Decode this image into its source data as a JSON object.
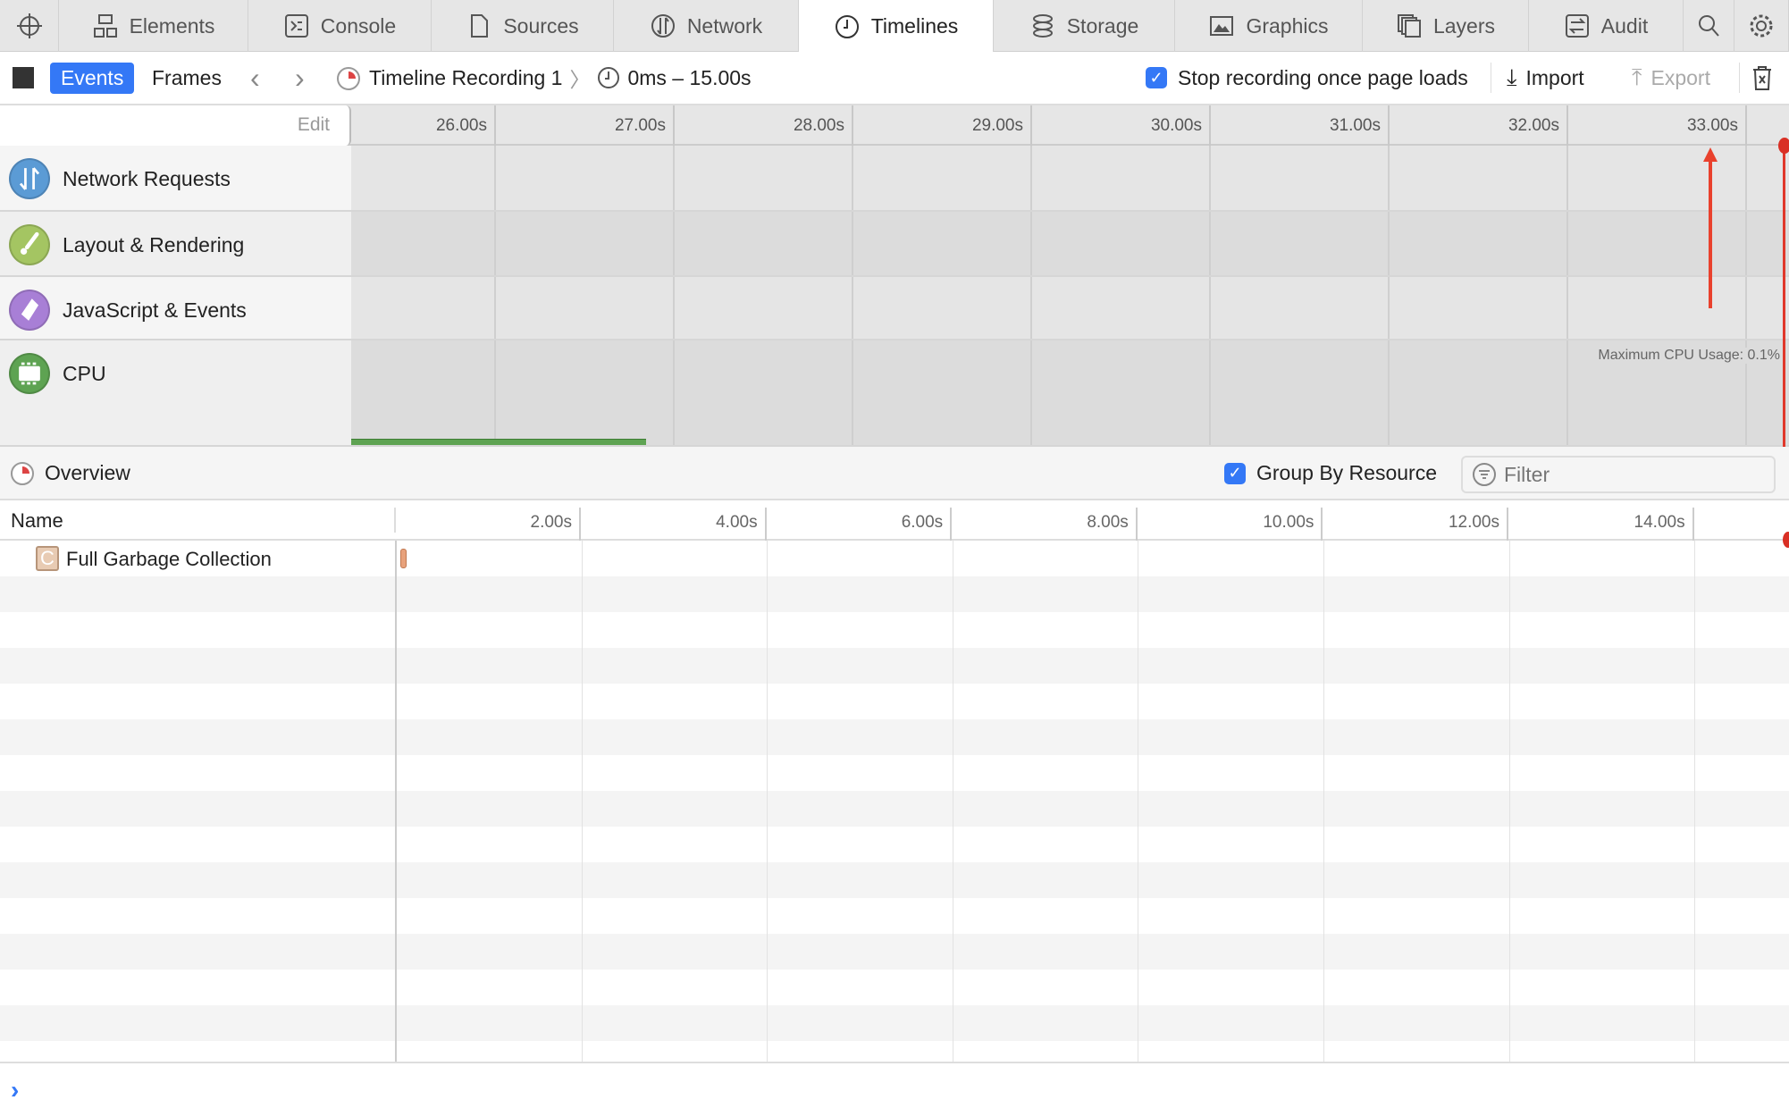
{
  "tabs": [
    {
      "label": "",
      "icon": "crosshair-icon"
    },
    {
      "label": "Elements",
      "icon": "elements-icon"
    },
    {
      "label": "Console",
      "icon": "console-icon"
    },
    {
      "label": "Sources",
      "icon": "document-icon"
    },
    {
      "label": "Network",
      "icon": "network-icon"
    },
    {
      "label": "Timelines",
      "icon": "clock-icon",
      "active": true
    },
    {
      "label": "Storage",
      "icon": "database-icon"
    },
    {
      "label": "Graphics",
      "icon": "image-icon"
    },
    {
      "label": "Layers",
      "icon": "layers-icon"
    },
    {
      "label": "Audit",
      "icon": "audit-icon"
    },
    {
      "label": "",
      "icon": "search-icon"
    },
    {
      "label": "",
      "icon": "gear-icon"
    }
  ],
  "toolbar": {
    "events": "Events",
    "frames": "Frames",
    "recording": "Timeline Recording 1",
    "range": "0ms – 15.00s",
    "stop_on_load": "Stop recording once page loads",
    "stop_on_load_checked": true,
    "import": "Import",
    "export": "Export"
  },
  "ruler": {
    "edit": "Edit",
    "ticks": [
      "26.00s",
      "27.00s",
      "28.00s",
      "29.00s",
      "30.00s",
      "31.00s",
      "32.00s",
      "33.00s"
    ]
  },
  "tracks": [
    {
      "label": "Network Requests",
      "icon": "network-requests-icon",
      "color": "#5b9bd5"
    },
    {
      "label": "Layout & Rendering",
      "icon": "paintbrush-icon",
      "color": "#a4c562"
    },
    {
      "label": "JavaScript & Events",
      "icon": "script-icon",
      "color": "#a87fd6"
    },
    {
      "label": "CPU",
      "icon": "cpu-icon",
      "color": "#5ea352"
    }
  ],
  "cpu": {
    "max_label": "Maximum CPU Usage: 0.1%"
  },
  "overview": {
    "label": "Overview",
    "group_by_resource": "Group By Resource",
    "group_checked": true,
    "filter_placeholder": "Filter"
  },
  "table": {
    "name_header": "Name",
    "ticks": [
      "2.00s",
      "4.00s",
      "6.00s",
      "8.00s",
      "10.00s",
      "12.00s",
      "14.00s"
    ],
    "rows": [
      {
        "name": "Full Garbage Collection",
        "icon": "garbage-collection-icon",
        "start_s": 0.03,
        "color": "#e8a27c"
      }
    ]
  },
  "colors": {
    "accent": "#3478f6",
    "marker": "#e0382b",
    "cpu": "#5ea352"
  }
}
